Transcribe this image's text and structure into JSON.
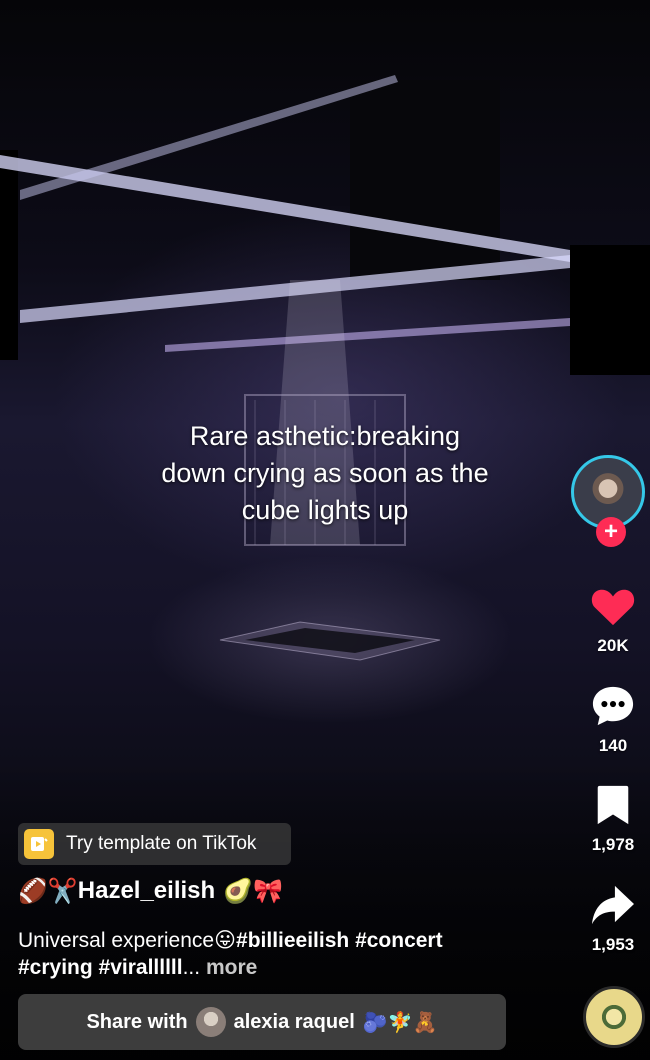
{
  "video": {
    "caption_line1": "Rare asthetic:breaking",
    "caption_line2": "down crying as soon as the",
    "caption_line3": "cube lights up"
  },
  "actions": {
    "follow_symbol": "+",
    "likes": "20K",
    "comments": "140",
    "saves": "1,978",
    "shares": "1,953"
  },
  "template_chip": {
    "label": "Try template on TikTok"
  },
  "author": {
    "prefix_emoji": "🏈✂️",
    "username": "Hazel_eilish",
    "suffix_emoji": "🥑🎀"
  },
  "description": {
    "text": "Universal experience",
    "emoji": "😛",
    "hashtags": "#billieeilish #concert",
    "hashtags2": "#crying #virallllll",
    "ellipsis": "... ",
    "more": "more"
  },
  "share_bar": {
    "prefix": "Share with",
    "name": "alexia raquel",
    "emoji": "🫐🧚🧸"
  },
  "colors": {
    "accent_red": "#fe2c55",
    "ring_cyan": "#35c8e8",
    "like_red": "#fe2c55"
  },
  "icons": [
    "heart-icon",
    "comment-icon",
    "bookmark-icon",
    "share-arrow-icon",
    "template-icon",
    "plus-icon"
  ]
}
